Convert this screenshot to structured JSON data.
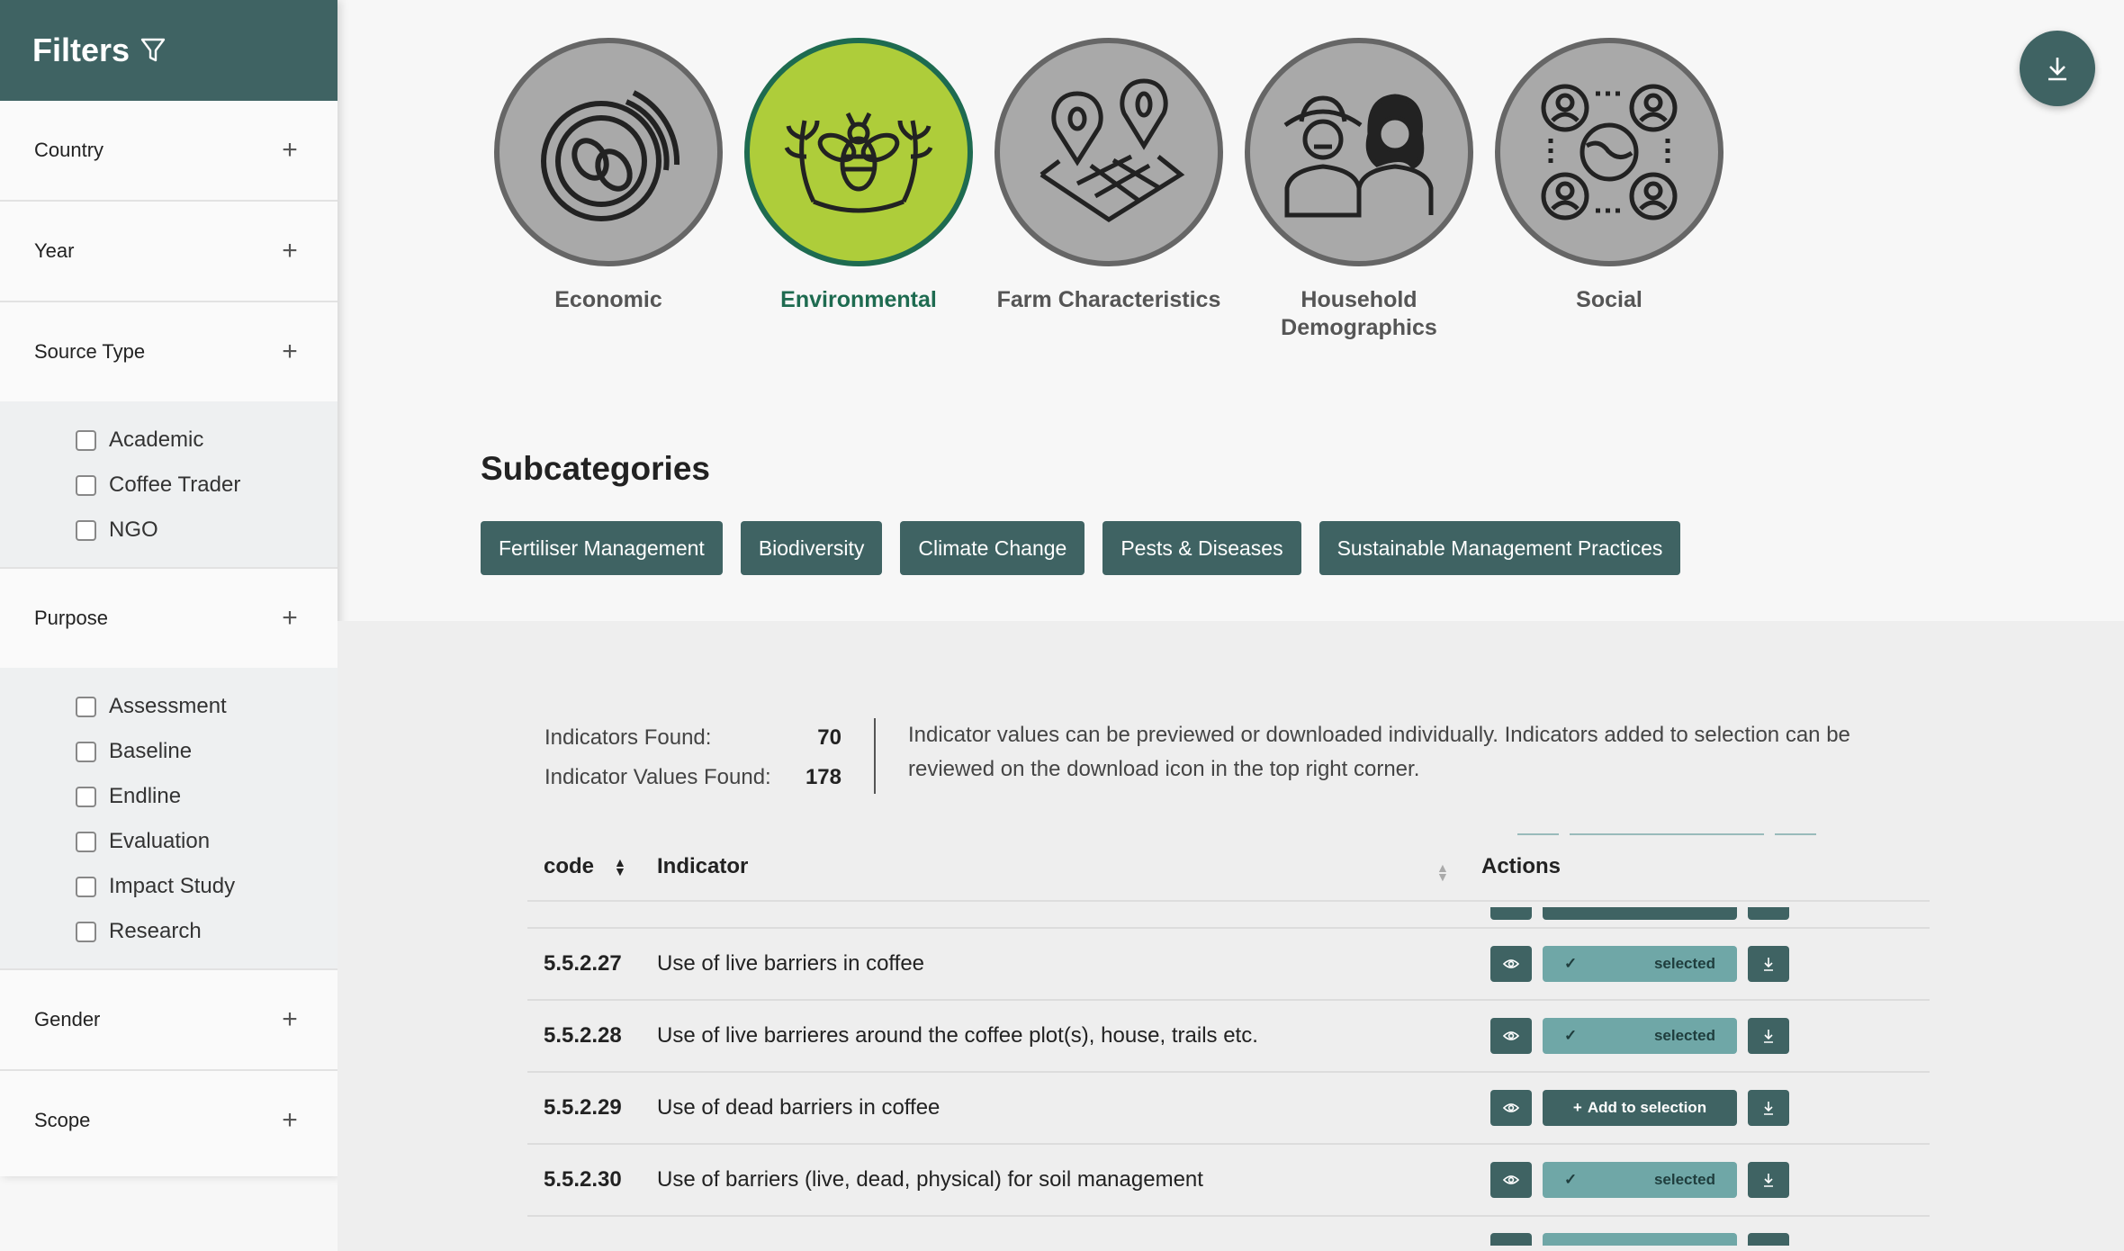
{
  "sidebar": {
    "title": "Filters",
    "sections": [
      {
        "label": "Country"
      },
      {
        "label": "Year"
      },
      {
        "label": "Source Type",
        "options": [
          "Academic",
          "Coffee Trader",
          "NGO"
        ]
      },
      {
        "label": "Purpose",
        "options": [
          "Assessment",
          "Baseline",
          "Endline",
          "Evaluation",
          "Impact Study",
          "Research"
        ]
      },
      {
        "label": "Gender"
      },
      {
        "label": "Scope"
      }
    ]
  },
  "categories": [
    {
      "label": "Economic",
      "icon": "coffee-bean-icon",
      "active": false
    },
    {
      "label": "Environmental",
      "icon": "bee-icon",
      "active": true
    },
    {
      "label": "Farm Characteristics",
      "icon": "map-pin-icon",
      "active": false
    },
    {
      "label": "Household Demographics",
      "icon": "people-icon",
      "active": false
    },
    {
      "label": "Social",
      "icon": "globe-people-icon",
      "active": false
    }
  ],
  "subcategories": {
    "title": "Subcategories",
    "chips": [
      "Fertiliser Management",
      "Biodiversity",
      "Climate Change",
      "Pests & Diseases",
      "Sustainable Management Practices"
    ]
  },
  "stats": {
    "indicators_label": "Indicators Found:",
    "indicators_value": "70",
    "values_label": "Indicator Values Found:",
    "values_value": "178",
    "info": "Indicator values can be previewed or downloaded individually. Indicators added to selection can be reviewed on the download icon in the top right corner."
  },
  "table": {
    "headers": {
      "code": "code",
      "indicator": "Indicator",
      "actions": "Actions"
    },
    "rows": [
      {
        "code": "5.5.2.27",
        "indicator": "Use of live barriers in coffee",
        "state": "selected"
      },
      {
        "code": "5.5.2.28",
        "indicator": "Use of live barrieres around the coffee plot(s), house, trails etc.",
        "state": "selected"
      },
      {
        "code": "5.5.2.29",
        "indicator": "Use of dead barriers in coffee",
        "state": "add"
      },
      {
        "code": "5.5.2.30",
        "indicator": "Use of barriers (live, dead, physical) for soil management",
        "state": "selected"
      }
    ],
    "selected_label": "selected",
    "add_label": "Add to selection"
  },
  "colors": {
    "primary": "#3f6363",
    "accent": "#aecd3a",
    "selected": "#6fa7a7"
  }
}
